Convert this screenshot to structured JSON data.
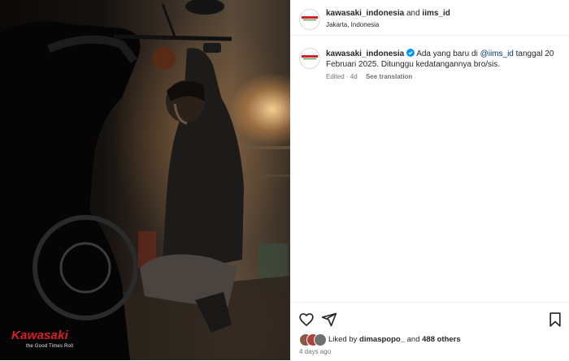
{
  "post": {
    "header": {
      "user": "kawasaki_indonesia",
      "and": "and",
      "collab": "iims_id",
      "location": "Jakarta, Indonesia"
    },
    "caption": {
      "user": "kawasaki_indonesia",
      "text_before": "Ada yang baru di ",
      "mention": "@iims_id",
      "text_after": " tanggal 20 Februari 2025. Ditunggu kedatangannya bro/sis.",
      "edited": "Edited",
      "separator": "·",
      "time": "4d",
      "see_translation": "See translation"
    },
    "likes": {
      "prefix": "Liked by",
      "user": "dimaspopo_",
      "and": "and",
      "others": "488 others"
    },
    "posted_ago": "4 days ago"
  },
  "photo": {
    "brand": "Kawasaki",
    "tagline": "the Good Times Roll"
  },
  "icons": {
    "verified": "verified-badge-icon",
    "like": "heart-icon",
    "share": "paper-plane-icon",
    "save": "bookmark-icon"
  },
  "colors": {
    "brand_red": "#d81f26",
    "verified_blue": "#0095f6",
    "mention": "#00376b",
    "muted": "#737373"
  }
}
